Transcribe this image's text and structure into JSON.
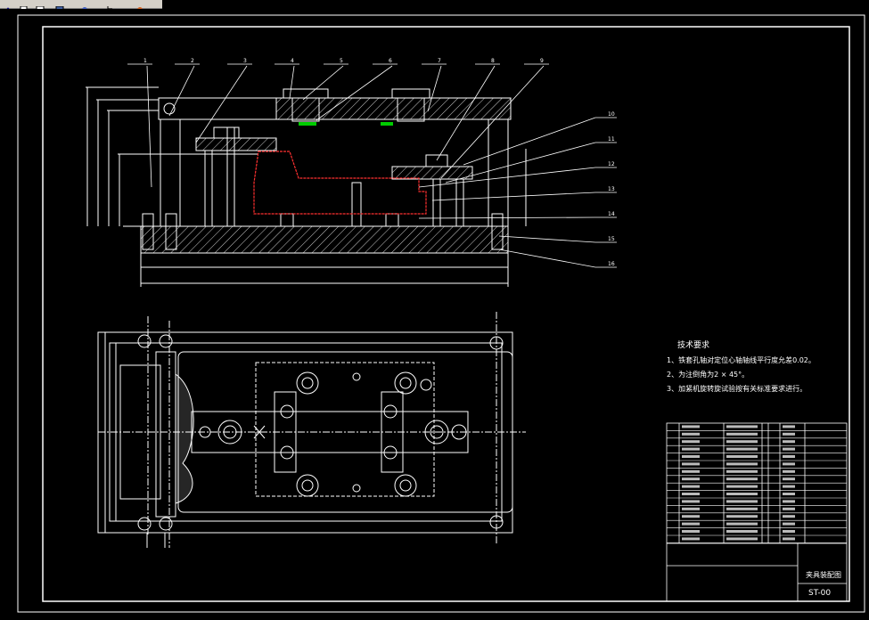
{
  "toolbar": {
    "buttons": [
      "arrow-tool",
      "new-file",
      "open-file",
      "save-file",
      "pointer-tool",
      "paint-tool"
    ]
  },
  "drawing": {
    "part_numbers": [
      "1",
      "2",
      "3",
      "4",
      "5",
      "6",
      "7",
      "8",
      "9",
      "10",
      "11",
      "12",
      "13",
      "14",
      "15",
      "16"
    ],
    "tech_title": "技术要求",
    "tech_notes": [
      "1、铁套孔轴对定位心轴轴线平行度允差0.02。",
      "2、为注倒角为2 × 45°。",
      "3、加紧机旋转旋试验按有关标准要求进行。"
    ],
    "title_block": {
      "name": "夹具装配图",
      "drawing_no": "ST-00"
    }
  },
  "colors": {
    "line": "#ffffff",
    "part_outline": "#ff3030",
    "highlight": "#00cc00",
    "toolbar": "#d4d0c8"
  }
}
